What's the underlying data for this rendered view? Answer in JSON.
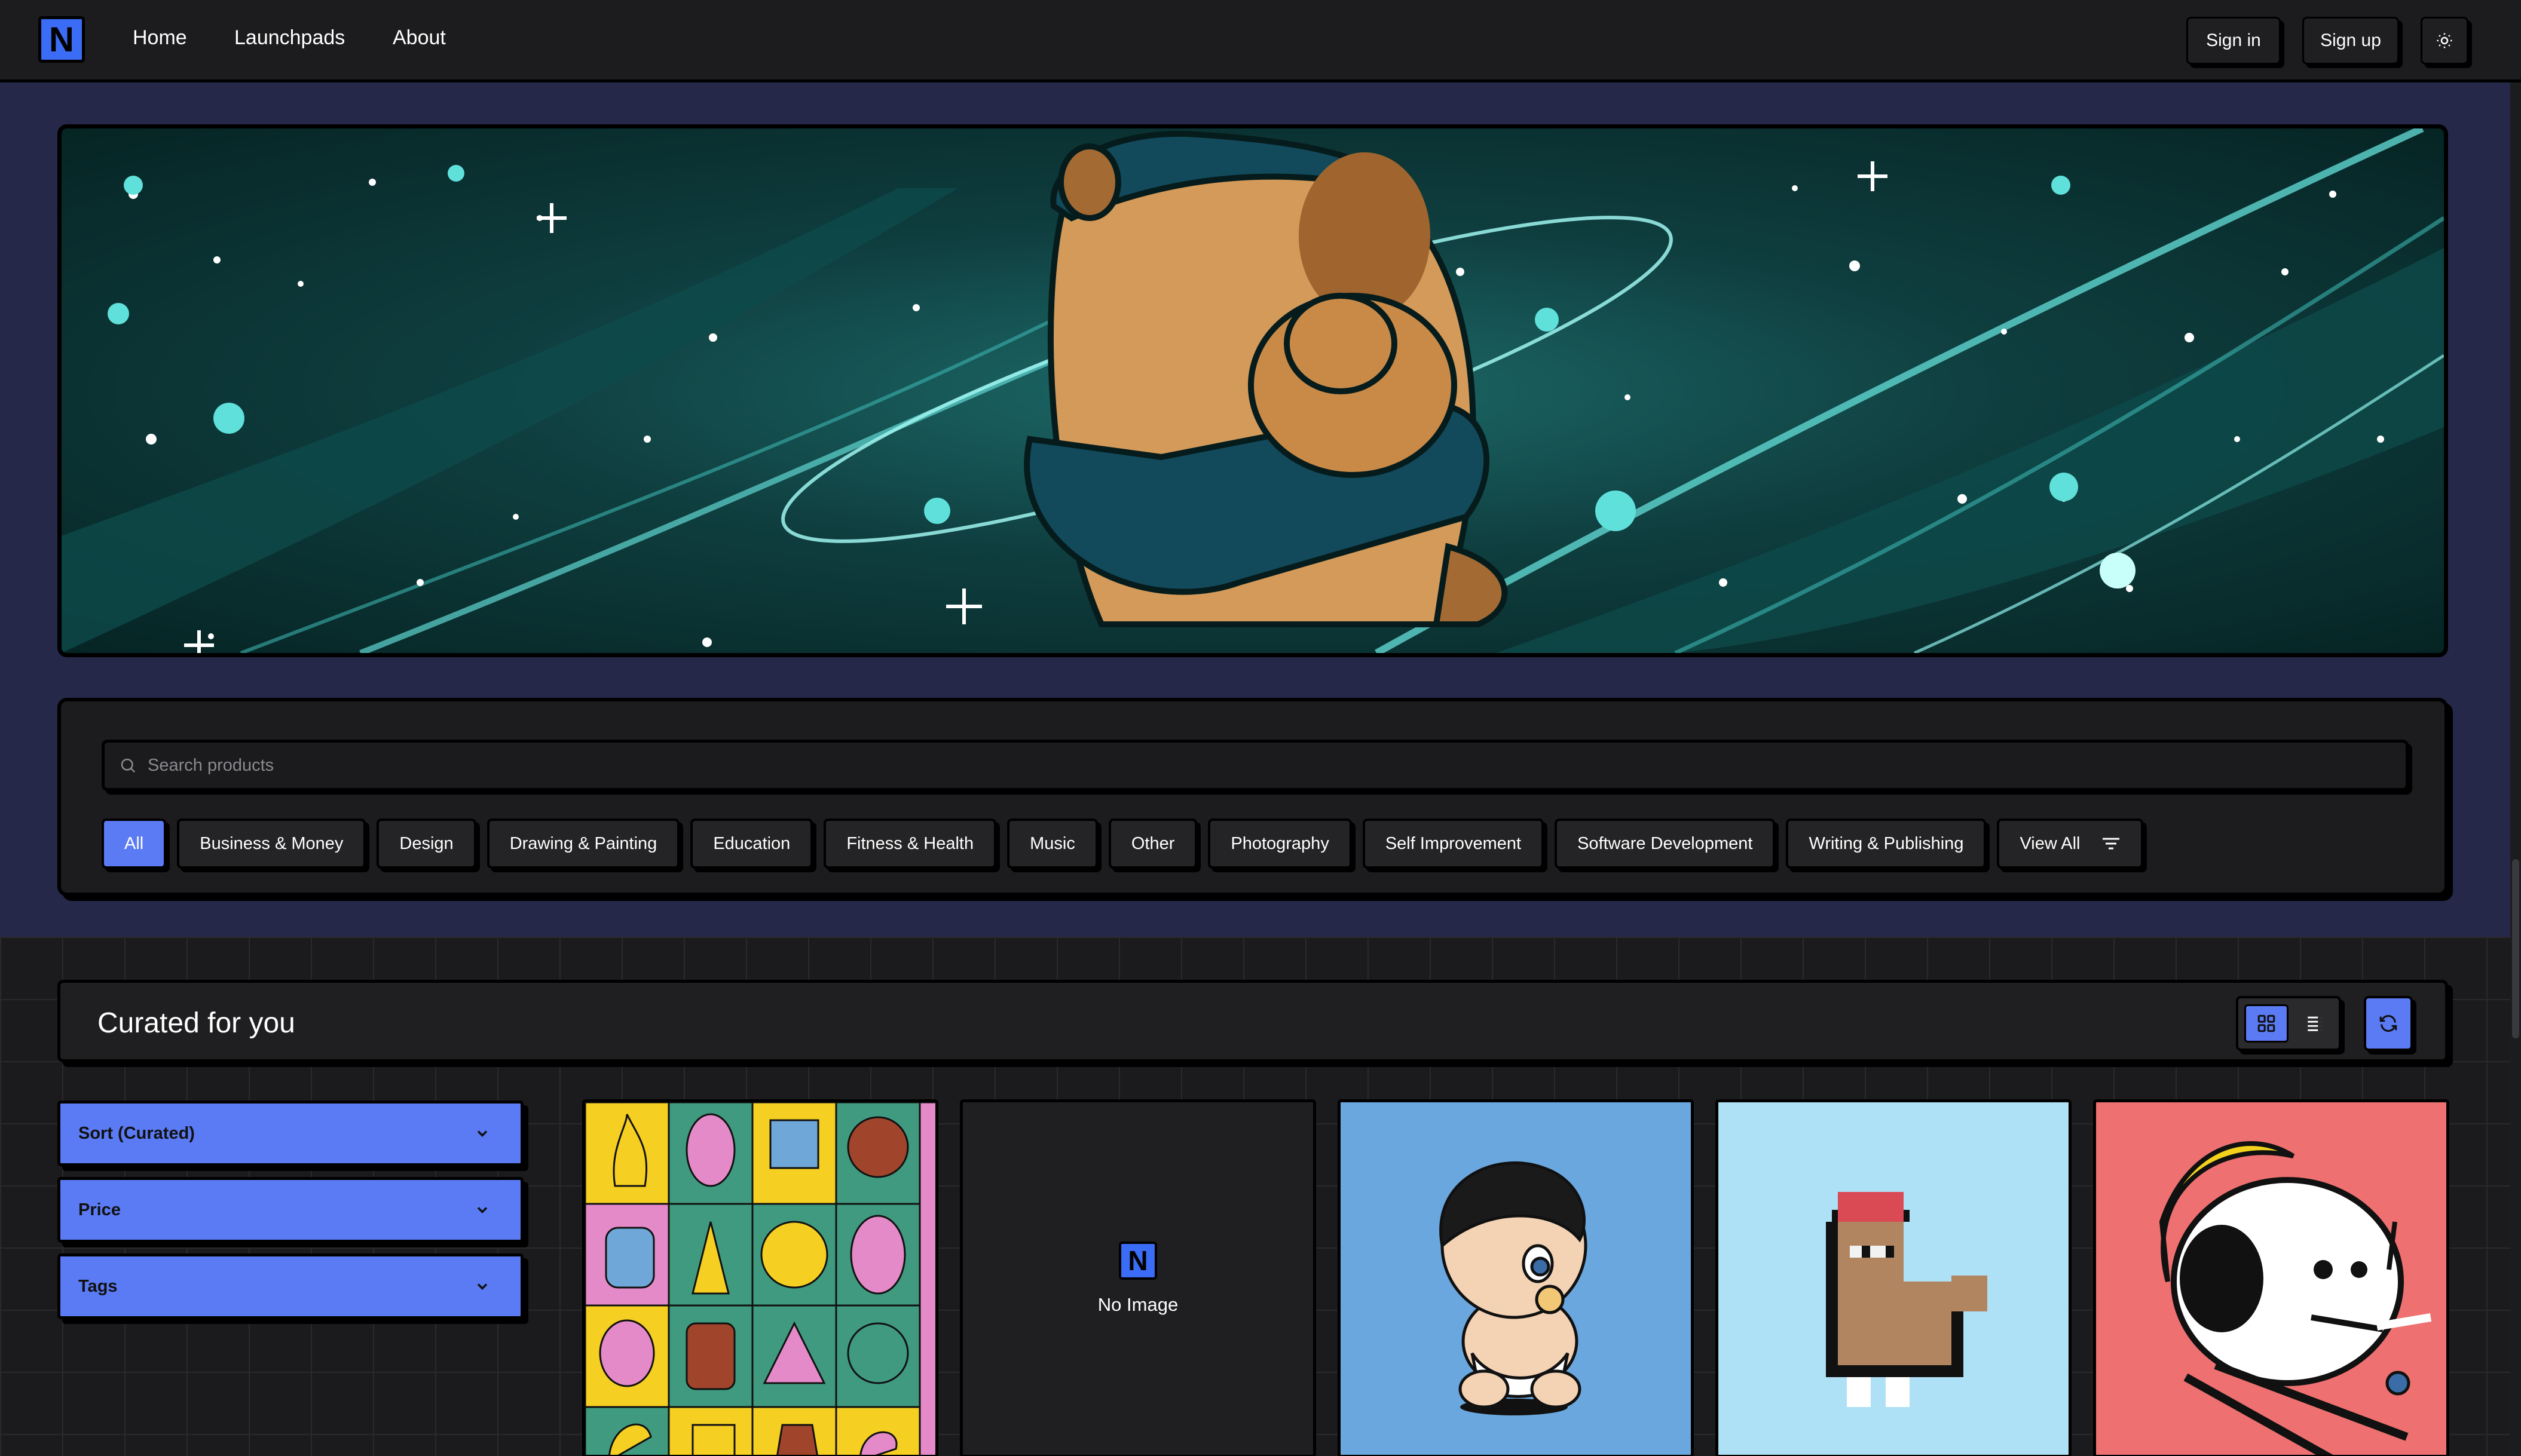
{
  "nav": {
    "logo": "N",
    "links": [
      "Home",
      "Launchpads",
      "About"
    ],
    "sign_in": "Sign in",
    "sign_up": "Sign up",
    "theme_icon": "sun-icon"
  },
  "search": {
    "placeholder": "Search products",
    "categories": [
      "All",
      "Business & Money",
      "Design",
      "Drawing & Painting",
      "Education",
      "Fitness & Health",
      "Music",
      "Other",
      "Photography",
      "Self Improvement",
      "Software Development",
      "Writing & Publishing"
    ],
    "view_all": "View All",
    "active_index": 0
  },
  "curated": {
    "title": "Curated for you"
  },
  "filters": {
    "sort": "Sort (Curated)",
    "price": "Price",
    "tags": "Tags"
  },
  "products": {
    "no_image_logo": "N",
    "no_image_label": "No Image"
  },
  "colors": {
    "accent": "#5b7bf5",
    "logo_blue": "#3b6cf6",
    "background": "#1a1a1c",
    "hero_bg": "#252849"
  }
}
